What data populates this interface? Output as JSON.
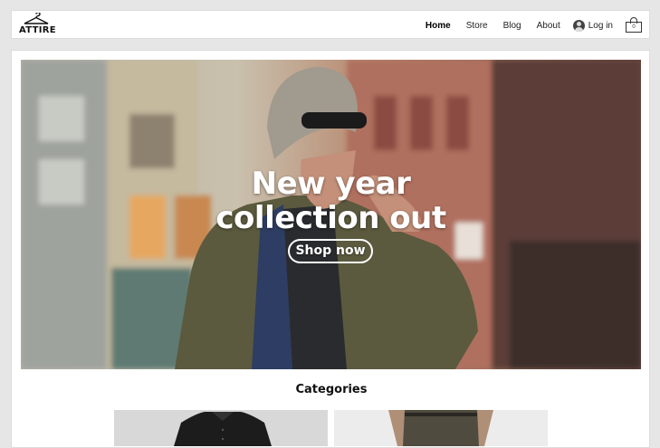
{
  "brand": {
    "name": "ATTIRE",
    "logo_icon": "hanger-icon"
  },
  "nav": {
    "items": [
      {
        "label": "Home",
        "active": true
      },
      {
        "label": "Store",
        "active": false
      },
      {
        "label": "Blog",
        "active": false
      },
      {
        "label": "About",
        "active": false
      }
    ],
    "login_label": "Log in",
    "cart_count": "0"
  },
  "hero": {
    "title": "New year collection out",
    "button_label": "Shop now"
  },
  "categories": {
    "title": "Categories"
  },
  "colors": {
    "page_bg": "#e6e6e6",
    "panel_bg": "#ffffff",
    "text": "#111111"
  }
}
